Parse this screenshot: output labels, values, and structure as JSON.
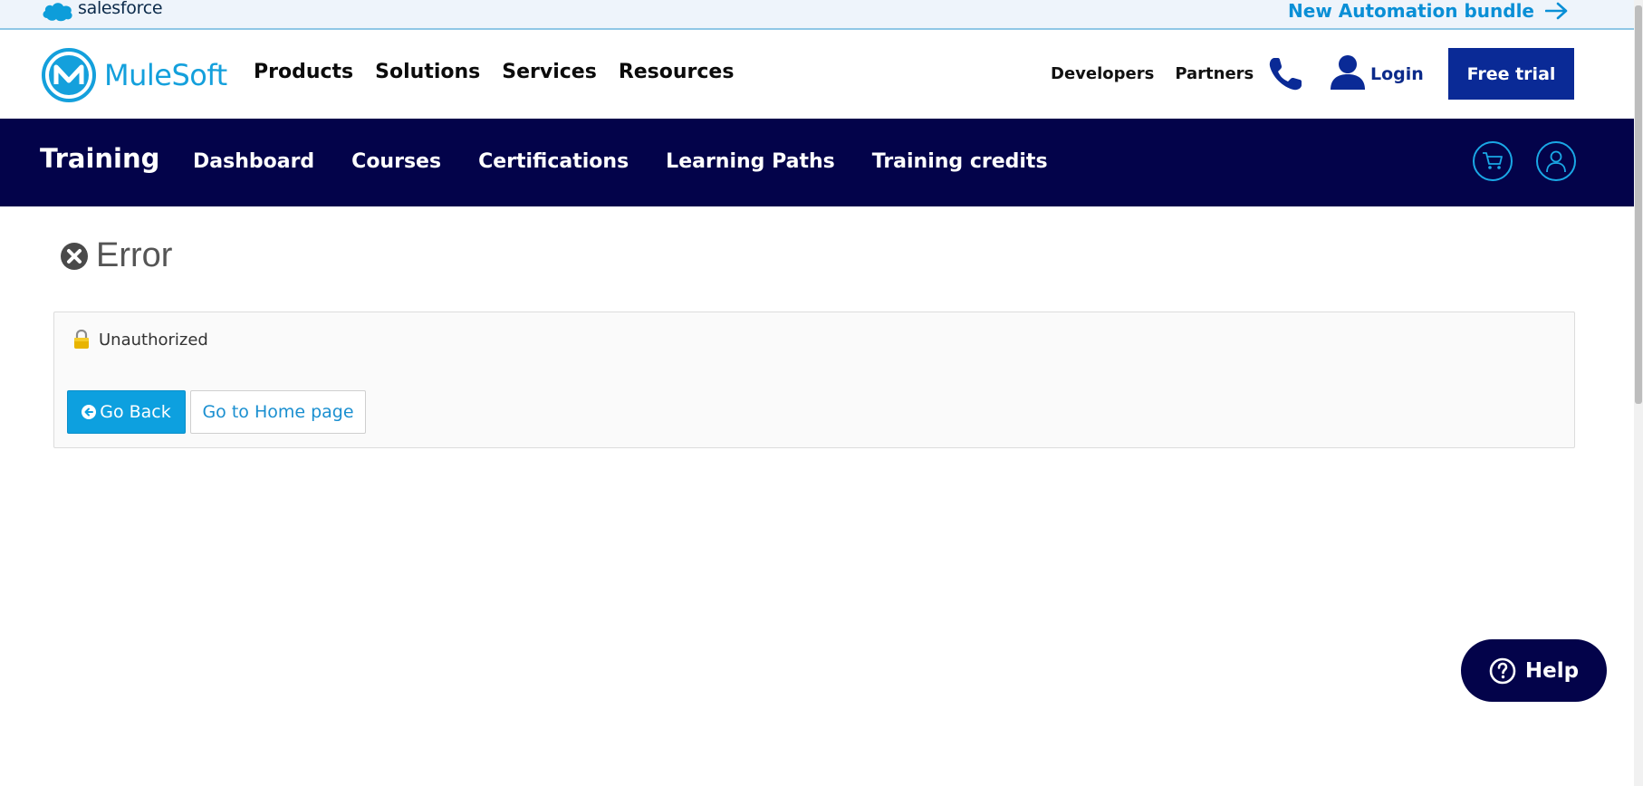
{
  "topbar": {
    "brand": "salesforce",
    "promo_link": "New Automation bundle"
  },
  "header": {
    "logo_text": "MuleSoft",
    "primary_nav": [
      "Products",
      "Solutions",
      "Services",
      "Resources"
    ],
    "secondary_nav": [
      "Developers",
      "Partners"
    ],
    "login_label": "Login",
    "free_trial_label": "Free trial"
  },
  "training_nav": {
    "title": "Training",
    "items": [
      "Dashboard",
      "Courses",
      "Certifications",
      "Learning Paths",
      "Training credits"
    ]
  },
  "main": {
    "heading": "Error",
    "message": "Unauthorized",
    "go_back_label": "Go Back",
    "home_label": "Go to Home page"
  },
  "help": {
    "label": "Help"
  },
  "colors": {
    "brand_blue": "#14a0dc",
    "dark_navy": "#03034a",
    "trial_blue": "#0a2a96",
    "link_blue": "#0a8fd6"
  }
}
